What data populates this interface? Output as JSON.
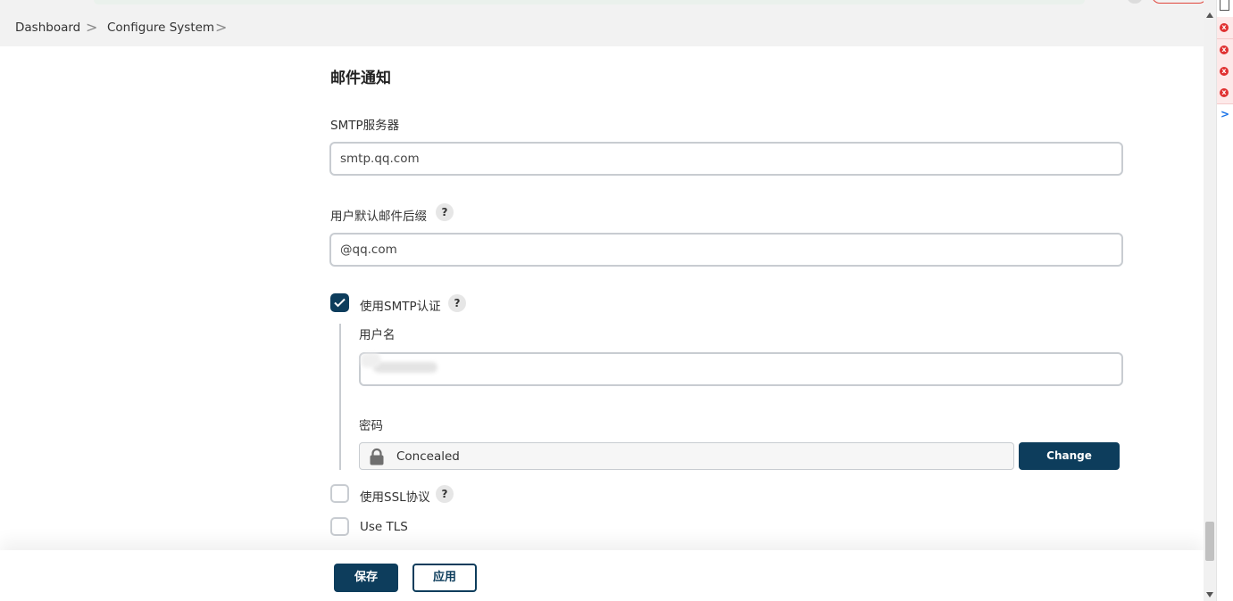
{
  "breadcrumb": {
    "items": [
      "Dashboard",
      "Configure System"
    ],
    "separator": ">"
  },
  "section": {
    "title": "邮件通知"
  },
  "smtp_server": {
    "label": "SMTP服务器",
    "value": "smtp.qq.com"
  },
  "default_suffix": {
    "label": "用户默认邮件后缀",
    "value": "@qq.com",
    "help": "?"
  },
  "smtp_auth": {
    "label": "使用SMTP认证",
    "checked": true,
    "help": "?",
    "username": {
      "label": "用户名",
      "value": ""
    },
    "password": {
      "label": "密码",
      "value": "Concealed",
      "change_button": "Change Password"
    }
  },
  "use_ssl": {
    "label": "使用SSL协议",
    "checked": false,
    "help": "?"
  },
  "use_tls": {
    "label": "Use TLS",
    "checked": false
  },
  "actions": {
    "save": "保存",
    "apply": "应用"
  },
  "devtools": {
    "errors": [
      "x",
      "x",
      "x",
      "x"
    ],
    "expand": ">"
  },
  "colors": {
    "primary": "#0d3d5c",
    "error": "#e03131",
    "border": "#c8ccd1"
  }
}
